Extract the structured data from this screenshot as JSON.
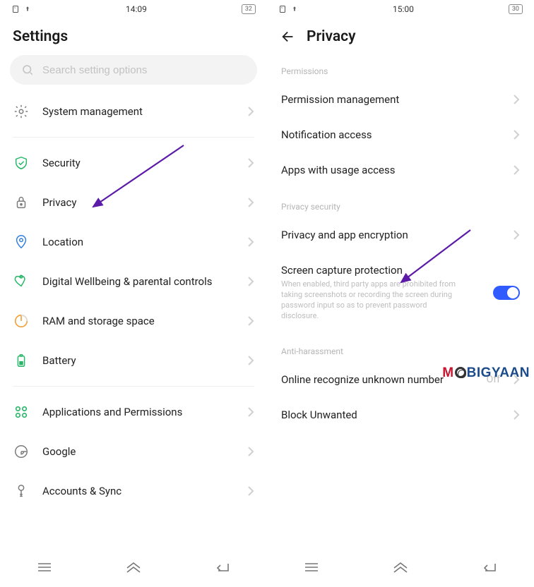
{
  "left": {
    "status": {
      "time": "14:09",
      "battery": "32"
    },
    "title": "Settings",
    "search_placeholder": "Search setting options",
    "items": [
      {
        "key": "system",
        "label": "System management"
      },
      {
        "key": "security",
        "label": "Security"
      },
      {
        "key": "privacy",
        "label": "Privacy"
      },
      {
        "key": "location",
        "label": "Location"
      },
      {
        "key": "wellbeing",
        "label": "Digital Wellbeing & parental controls"
      },
      {
        "key": "storage",
        "label": "RAM and storage space"
      },
      {
        "key": "battery",
        "label": "Battery"
      },
      {
        "key": "apps",
        "label": "Applications and Permissions"
      },
      {
        "key": "google",
        "label": "Google"
      },
      {
        "key": "accounts",
        "label": "Accounts & Sync"
      }
    ]
  },
  "right": {
    "status": {
      "time": "15:00",
      "battery": "30"
    },
    "title": "Privacy",
    "sections": {
      "permissions": {
        "title": "Permissions",
        "items": [
          {
            "key": "perm_mgmt",
            "label": "Permission management"
          },
          {
            "key": "notif",
            "label": "Notification access"
          },
          {
            "key": "usage",
            "label": "Apps with usage access"
          }
        ]
      },
      "privacy_security": {
        "title": "Privacy security",
        "items": [
          {
            "key": "encryption",
            "label": "Privacy and app encryption"
          },
          {
            "key": "screen_protect",
            "label": "Screen capture protection",
            "desc": "When enabled, third party apps are prohibited from taking screenshots or recording the screen during password input so as to prevent password disclosure.",
            "toggle": true
          }
        ]
      },
      "anti_harassment": {
        "title": "Anti-harassment",
        "items": [
          {
            "key": "unknown_number",
            "label": "Online recognize unknown number",
            "status": "Off"
          },
          {
            "key": "block_unwanted",
            "label": "Block Unwanted"
          }
        ]
      }
    }
  },
  "watermark": {
    "part1": "M",
    "part2": "BI",
    "part3": "GYAAN"
  },
  "annotation": {
    "arrow_color": "#5b1aa8"
  }
}
